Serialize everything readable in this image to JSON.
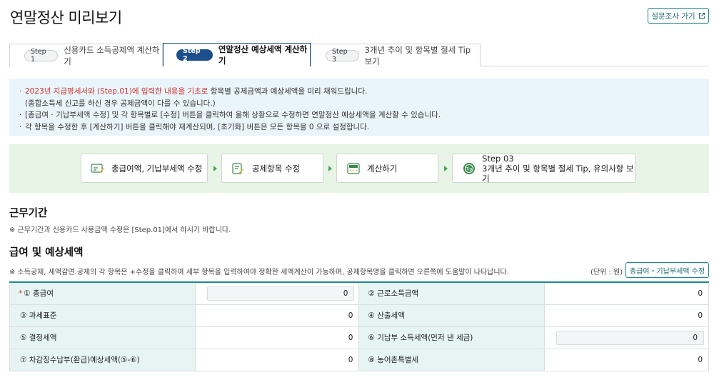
{
  "page": {
    "title": "연말정산 미리보기",
    "survey_button": "설문조사 가기"
  },
  "tabs": [
    {
      "step": "Step 1",
      "label": "신용카드 소득공제액 계산하기",
      "active": false
    },
    {
      "step": "Step 2",
      "label": "연말정산 예상세액 계산하기",
      "active": true
    },
    {
      "step": "Step 3",
      "label": "3개년 추이 및 항목별 절세 Tip 보기",
      "active": false
    }
  ],
  "notice": {
    "line1_red": "2023년 지급명세서와 (Step.01)에 입력한 내용을 기초로",
    "line1_rest": " 항목별 공제금액과 예상세액을 미리 채워드립니다.",
    "line2": "(종합소득세 신고를 하신 경우 공제금액이 다를 수 있습니다.)",
    "line3": "[총급여 · 기납부세액 수정] 및 각 항목별로 [수정] 버튼을 클릭하여 올해 상황으로 수정하면 연말정산 예상세액을 계산할 수 있습니다.",
    "line4": "각 항목을 수정한 후 [계산하기] 버튼을 클릭해야 재계산되며, [초기화] 버튼은 모든 항목을 0 으로 설정합니다."
  },
  "steps": [
    {
      "label": "총급여액, 기납부세액 수정",
      "icon": "salary-edit-icon"
    },
    {
      "label": "공제항목 수정",
      "icon": "deduction-edit-icon"
    },
    {
      "label": "계산하기",
      "icon": "calculator-icon"
    },
    {
      "label_line1": "Step 03",
      "label_line2": "3개년 추이 및 항목별 절세 Tip, 유의사항 보기",
      "icon": "tip-icon"
    }
  ],
  "work_period": {
    "title": "근무기간",
    "note": "※ 근무기간과 신용카드 사용금액 수정은 [Step.01]에서 하시기 바랍니다."
  },
  "salary_tax": {
    "title": "급여 및 예상세액",
    "note": "※ 소득공제, 세액감면.공제의 각 항목은 +수정을 클릭하여 세부 항목을 입력하여야 정확한 세액계산이 가능하며, 공제항목명을 클릭하면 오른쪽에 도움말이 나타납니다.",
    "unit": "(단위 : 원)",
    "edit_button": "총급여・기납부세액 수정",
    "rows": [
      {
        "l_label": "① 총급여",
        "l_value": "0",
        "r_label": "② 근로소득금액",
        "r_value": "0"
      },
      {
        "l_label": "③ 과세표준",
        "l_value": "0",
        "r_label": "④ 산출세액",
        "r_value": "0"
      },
      {
        "l_label": "⑤ 결정세액",
        "l_value": "0",
        "r_label": "⑥ 기납부 소득세액(먼저 낸 세금)",
        "r_value": "0"
      },
      {
        "l_label": "⑦ 차감징수납부(환급)예상세액(⑤-⑥)",
        "l_value": "0",
        "r_label": "⑧ 농어촌특별세",
        "r_value": "0"
      }
    ]
  },
  "colors": {
    "teal": "#1a8a8a",
    "navy": "#1d4f8c",
    "red": "#d0312d",
    "notice_bg": "#eaf4fb",
    "steps_bg": "#e7f4e6",
    "label_bg": "#e6f4f3"
  }
}
